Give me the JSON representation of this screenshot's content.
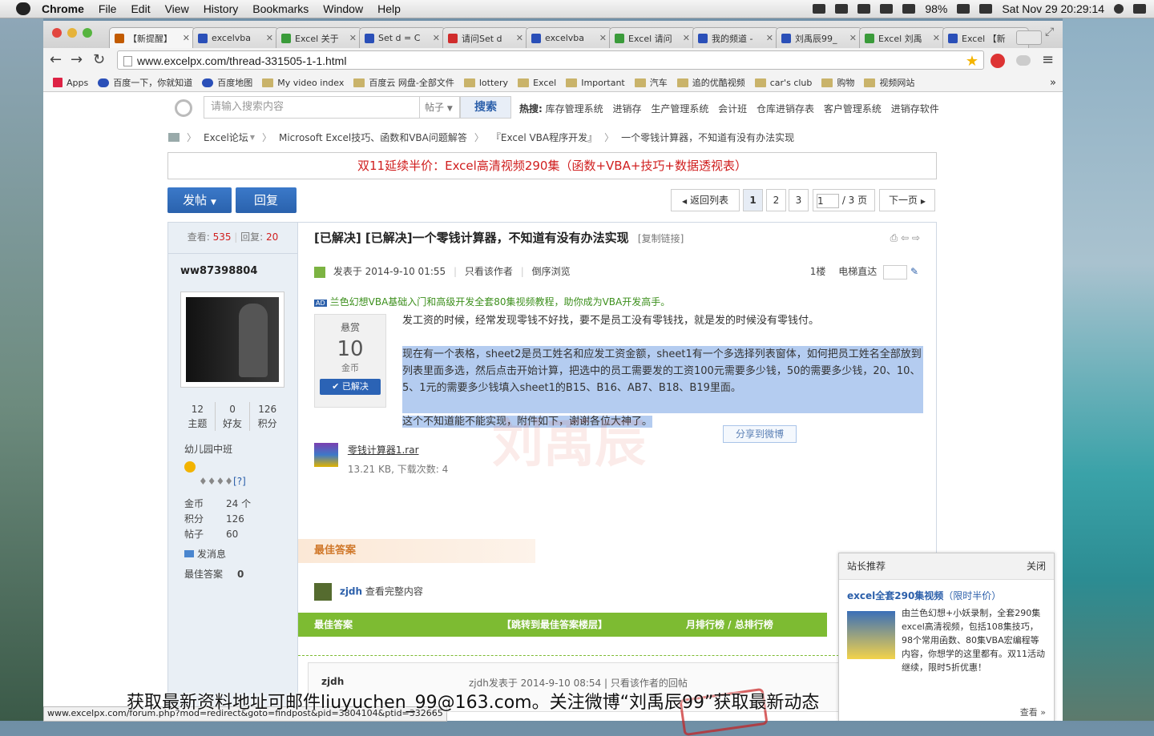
{
  "menubar": {
    "app": "Chrome",
    "items": [
      "File",
      "Edit",
      "View",
      "History",
      "Bookmarks",
      "Window",
      "Help"
    ],
    "battery": "98%",
    "clock": "Sat Nov 29  20:29:14"
  },
  "tabs": [
    {
      "title": "【新提醒】",
      "color": "#c25b00"
    },
    {
      "title": "excelvba",
      "color": "#2a4fb8"
    },
    {
      "title": "Excel 关于",
      "color": "#3a9b3a"
    },
    {
      "title": "Set d = C",
      "color": "#2a4fb8"
    },
    {
      "title": "请问Set d",
      "color": "#d02c2c"
    },
    {
      "title": "excelvba",
      "color": "#2a4fb8"
    },
    {
      "title": "Excel 请问",
      "color": "#3a9b3a"
    },
    {
      "title": "我的频道 -",
      "color": "#2a4fb8"
    },
    {
      "title": "刘禹辰99_",
      "color": "#2a4fb8"
    },
    {
      "title": "Excel 刘禹",
      "color": "#3a9b3a"
    },
    {
      "title": "Excel 【新",
      "color": "#2a4fb8"
    }
  ],
  "address": "www.excelpx.com/thread-331505-1-1.html",
  "bookmarks": [
    "Apps",
    "百度一下，你就知道",
    "百度地图",
    "My video index",
    "百度云 网盘-全部文件",
    "lottery",
    "Excel",
    "Important",
    "汽车",
    "追的优酷视频",
    "car's club",
    "购物",
    "视频网站"
  ],
  "search": {
    "placeholder": "请输入搜索内容",
    "type": "帖子",
    "button": "搜索",
    "hot_label": "热搜:",
    "hot": [
      "库存管理系统",
      "进销存",
      "生产管理系统",
      "会计班",
      "仓库进销存表",
      "客户管理系统",
      "进销存软件"
    ]
  },
  "breadcrumb": [
    "Excel论坛",
    "Microsoft Excel技巧、函数和VBA问题解答",
    "『Excel VBA程序开发』",
    "一个零钱计算器，不知道有没有办法实现"
  ],
  "promo": "双11延续半价：Excel高清视频290集（函数+VBA+技巧+数据透视表）",
  "actions": {
    "post": "发帖",
    "reply": "回复"
  },
  "pager": {
    "back": "返回列表",
    "pages": [
      "1",
      "2",
      "3"
    ],
    "current": "1",
    "total": "/ 3 页",
    "next": "下一页"
  },
  "thread": {
    "views_label": "查看:",
    "views": "535",
    "replies_label": "回复:",
    "replies": "20",
    "title": "[已解决] [已解决]一个零钱计算器，不知道有没有办法实现",
    "copy_link": "[复制链接]"
  },
  "author": {
    "name": "ww87398804",
    "topics": "12",
    "topics_label": "主题",
    "friends": "0",
    "friends_label": "好友",
    "points": "126",
    "points_label": "积分",
    "level": "幼儿园中班",
    "gold_label": "金币",
    "gold": "24 个",
    "points_label2": "积分",
    "points2": "126",
    "posts_label": "帖子",
    "posts": "60",
    "send_msg": "发消息",
    "best_label": "最佳答案",
    "best": "0"
  },
  "post": {
    "posted": "发表于 2014-9-10 01:55",
    "only_author": "只看该作者",
    "reverse": "倒序浏览",
    "floor": "1楼",
    "jump": "电梯直达",
    "ad": "兰色幻想VBA基础入门和高级开发全套80集视频教程，助你成为VBA开发高手。",
    "reward_label": "悬赏",
    "reward": "10",
    "reward_unit": "金币",
    "solved": "已解决",
    "p1": "发工资的时候，经常发现零钱不好找，要不是员工没有零钱找，就是发的时候没有零钱付。",
    "p2": "现在有一个表格，sheet2是员工姓名和应发工资金额，sheet1有一个多选择列表窗体，如何把员工姓名全部放到列表里面多选，然后点击开始计算，把选中的员工需要发的工资100元需要多少钱，50的需要多少钱，20、10、5、1元的需要多少钱填入sheet1的B15、B16、AB7、B18、B19里面。",
    "p3": "这个不知道能不能实现，附件如下，谢谢各位大神了。",
    "share": "分享到微博",
    "attach_name": "零钱计算器1.rar",
    "attach_meta": "13.21 KB, 下载次数: 4"
  },
  "best_answer": {
    "title": "最佳答案",
    "user": "zjdh",
    "view": "查看完整内容",
    "bar_left": "最佳答案",
    "bar_mid": "【跳转到最佳答案楼层】",
    "bar_right": "月排行榜 / 总排行榜"
  },
  "next_post": {
    "user": "zjdh",
    "meta": "zjdh发表于 2014-9-10 08:54 | 只看该作者的回帖"
  },
  "recommend": {
    "header": "站长推荐",
    "close": "关闭",
    "title": "excel全套290集视频",
    "title_note": "（限时半价）",
    "desc": "由兰色幻想+小妖录制，全套290集excel高清视频，包括108集技巧，98个常用函数、80集VBA宏编程等内容，你想学的这里都有。双11活动继续，限时5折优惠！",
    "more": "查看 »"
  },
  "status_url": "www.excelpx.com/forum.php?mod=redirect&goto=findpost&pid=3804104&ptid=332665",
  "overlay_text": "获取最新资料地址可邮件liuyuchen_99@163.com。关注微博“刘禹辰99”获取最新动态"
}
